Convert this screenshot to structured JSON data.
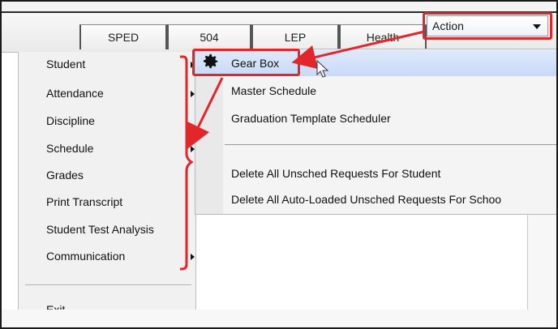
{
  "tabs": [
    "SPED",
    "504",
    "LEP",
    "Health"
  ],
  "action": {
    "label": "Action"
  },
  "menu": {
    "items": [
      {
        "label": "Student",
        "has_submenu": true
      },
      {
        "label": "Attendance",
        "has_submenu": true
      },
      {
        "label": "Discipline",
        "has_submenu": false
      },
      {
        "label": "Schedule",
        "has_submenu": true
      },
      {
        "label": "Grades",
        "has_submenu": false
      },
      {
        "label": "Print Transcript",
        "has_submenu": false
      },
      {
        "label": "Student Test Analysis",
        "has_submenu": false
      },
      {
        "label": "Communication",
        "has_submenu": true
      }
    ],
    "exit_label": "Exit"
  },
  "submenu": {
    "items": [
      {
        "label": "Gear Box",
        "icon": "gear-icon",
        "highlighted": true
      },
      {
        "label": "Master Schedule"
      },
      {
        "label": "Graduation Template Scheduler"
      },
      {
        "label": "Delete All Unsched Requests For Student"
      },
      {
        "label": "Delete All Auto-Loaded Unsched Requests For Schoo"
      }
    ]
  },
  "colors": {
    "highlight_red": "#e3262a",
    "selection_blue": "#c8daf7"
  }
}
